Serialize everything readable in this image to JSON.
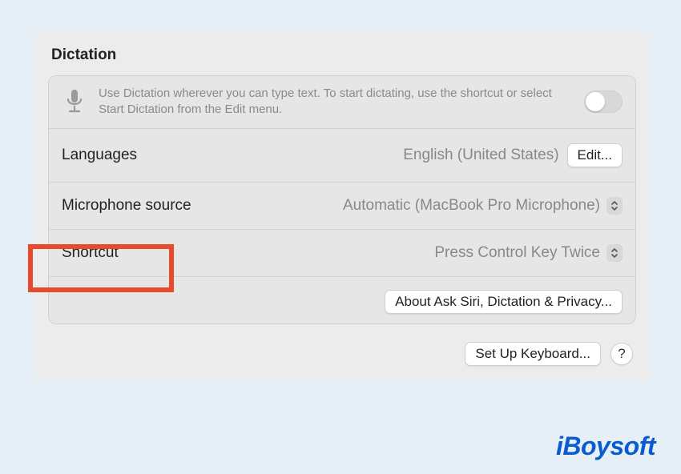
{
  "section": {
    "title": "Dictation"
  },
  "info": {
    "description": "Use Dictation wherever you can type text. To start dictating, use the shortcut or select Start Dictation from the Edit menu.",
    "toggle_on": false
  },
  "rows": {
    "languages": {
      "label": "Languages",
      "value": "English (United States)",
      "edit_button": "Edit..."
    },
    "microphone": {
      "label": "Microphone source",
      "value": "Automatic (MacBook Pro Microphone)"
    },
    "shortcut": {
      "label": "Shortcut",
      "value": "Press Control Key Twice"
    }
  },
  "actions": {
    "privacy_button": "About Ask Siri, Dictation & Privacy...",
    "setup_button": "Set Up Keyboard...",
    "help": "?"
  },
  "watermark": "iBoysoft"
}
